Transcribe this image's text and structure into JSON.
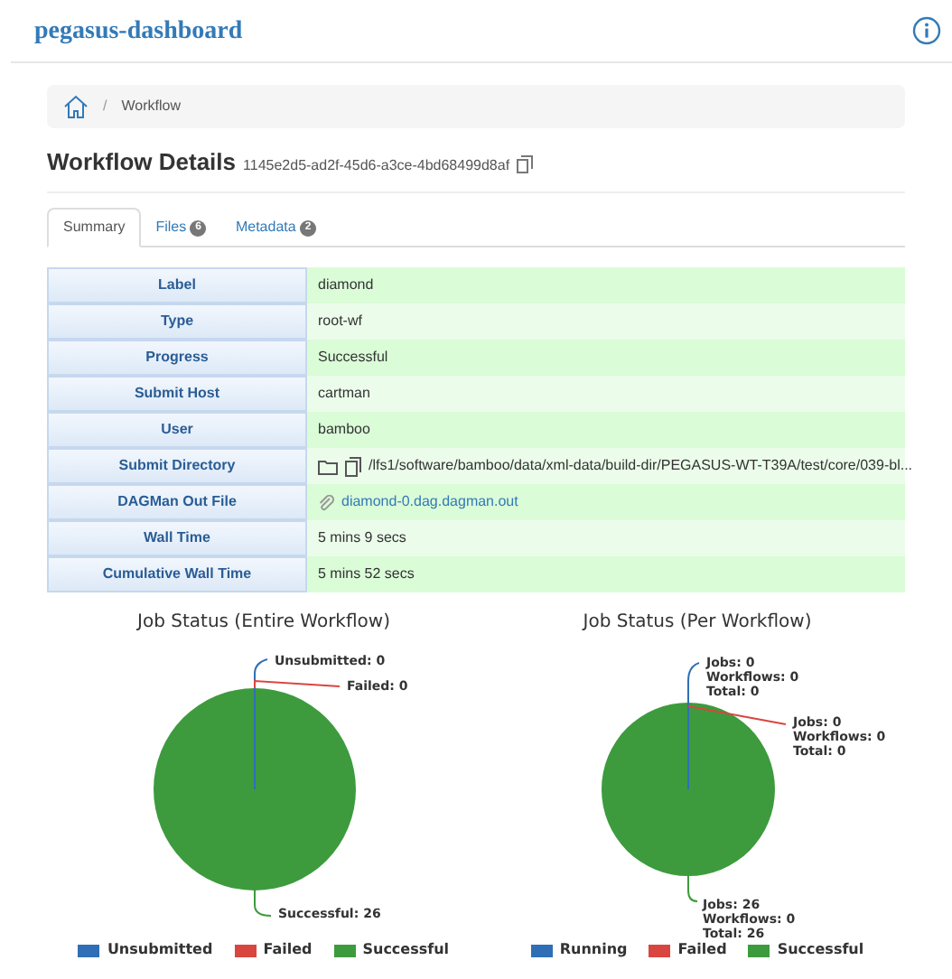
{
  "brand": "pegasus-dashboard",
  "breadcrumb": {
    "separator": "/",
    "current": "Workflow"
  },
  "heading": {
    "title": "Workflow Details",
    "id": "1145e2d5-ad2f-45d6-a3ce-4bd68499d8af"
  },
  "tabs": [
    {
      "label": "Summary",
      "selected": true
    },
    {
      "label": "Files",
      "count": "6",
      "selected": false
    },
    {
      "label": "Metadata",
      "count": "2",
      "selected": false
    }
  ],
  "details": [
    {
      "label": "Label",
      "value": "diamond",
      "kind": "text"
    },
    {
      "label": "Type",
      "value": "root-wf",
      "kind": "text"
    },
    {
      "label": "Progress",
      "value": "Successful",
      "kind": "text"
    },
    {
      "label": "Submit Host",
      "value": "cartman",
      "kind": "text"
    },
    {
      "label": "User",
      "value": "bamboo",
      "kind": "text"
    },
    {
      "label": "Submit Directory",
      "value": "/lfs1/software/bamboo/data/xml-data/build-dir/PEGASUS-WT-T39A/test/core/039-bl...",
      "kind": "path"
    },
    {
      "label": "DAGMan Out File",
      "value": "diamond-0.dag.dagman.out",
      "kind": "link"
    },
    {
      "label": "Wall Time",
      "value": "5 mins 9 secs",
      "kind": "text"
    },
    {
      "label": "Cumulative Wall Time",
      "value": "5 mins 52 secs",
      "kind": "text"
    }
  ],
  "charts": [
    {
      "chart_data": {
        "type": "pie",
        "title": "Job Status (Entire Workflow)",
        "categories": [
          "Unsubmitted",
          "Failed",
          "Successful"
        ],
        "values": [
          0,
          0,
          100
        ],
        "value_labels": [
          [
            "Unsubmitted: 0"
          ],
          [
            "Failed: 0"
          ],
          [
            "Successful: 26"
          ]
        ]
      },
      "legend": [
        {
          "color": "#2f6fb5"
        },
        {
          "color": "#d9453f"
        },
        {
          "color": "#3d9b3d"
        }
      ]
    },
    {
      "chart_data": {
        "type": "pie",
        "title": "Job Status (Per Workflow)",
        "categories": [
          "Running",
          "Failed",
          "Successful"
        ],
        "values": [
          0,
          0,
          100
        ],
        "value_labels": [
          [
            "Jobs: 0",
            "Workflows: 0",
            "Total: 0"
          ],
          [
            "Jobs: 0",
            "Workflows: 0",
            "Total: 0"
          ],
          [
            "Jobs: 26",
            "Workflows: 0",
            "Total: 26"
          ]
        ]
      },
      "legend": [
        {
          "color": "#2f6fb5"
        },
        {
          "color": "#d9453f"
        },
        {
          "color": "#3d9b3d"
        }
      ]
    }
  ]
}
